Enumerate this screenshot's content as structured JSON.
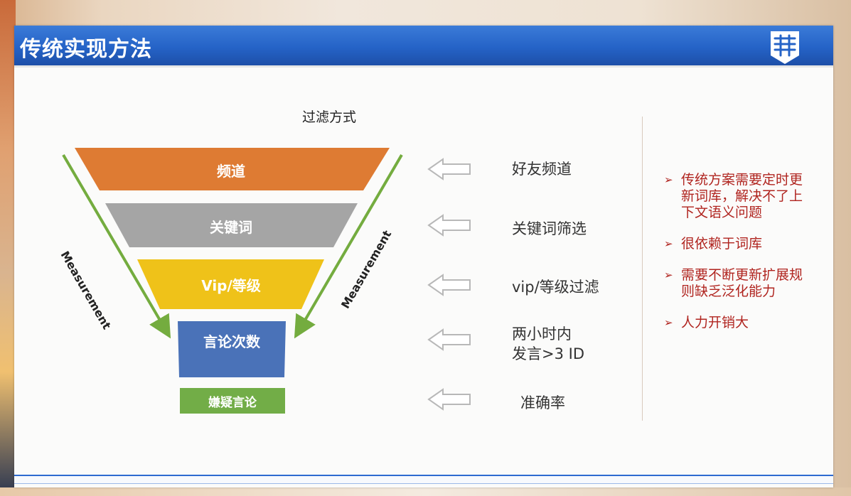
{
  "slide": {
    "title": "传统实现方法",
    "funnel_heading": "过滤方式"
  },
  "funnel": {
    "layers": [
      {
        "label": "频道",
        "color": "#de7b33"
      },
      {
        "label": "关键词",
        "color": "#a5a5a5"
      },
      {
        "label": "Vip/等级",
        "color": "#efc219"
      },
      {
        "label": "言论次数",
        "color": "#4a72b8"
      },
      {
        "label": "嫌疑言论",
        "color": "#72ad47"
      }
    ],
    "side_label_left": "Measurement",
    "side_label_right": "Measurement",
    "arrow_color": "#74ac3f"
  },
  "methods": [
    {
      "lines": [
        "好友频道"
      ]
    },
    {
      "lines": [
        "关键词筛选"
      ]
    },
    {
      "lines": [
        "vip/等级过滤"
      ]
    },
    {
      "lines": [
        "两小时内",
        "发言>3 ID"
      ]
    },
    {
      "lines": [
        "准确率"
      ]
    }
  ],
  "drawbacks": {
    "marker": "➢",
    "accent_color": "#b0241f",
    "items": [
      "传统方案需要定时更新词库，解决不了上下文语义问题",
      "很依赖于词库",
      "需要不断更新扩展规则缺乏泛化能力",
      "人力开销大"
    ]
  },
  "colors": {
    "header_blue": "#2563c7",
    "slide_bg": "#fbfbfa"
  }
}
